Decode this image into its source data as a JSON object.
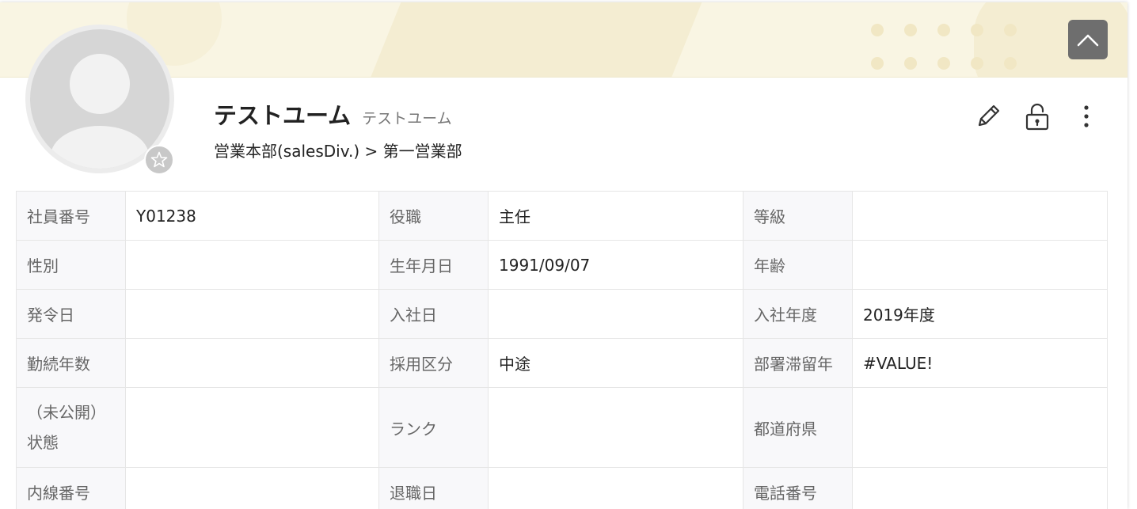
{
  "profile": {
    "name": "テストユーム",
    "name_kana": "テストユーム",
    "department_path": "営業本部(salesDiv.) > 第一営業部"
  },
  "colors": {
    "banner": "#f9f5e3",
    "dots": "#f1e7c4",
    "top_button": "#6e6e6e",
    "label_bg": "#f8f8fa"
  },
  "icons": {
    "scroll_top": "chevron-up-icon",
    "favorite": "star-outline-icon",
    "edit": "pencil-icon",
    "lock": "lock-icon",
    "more": "more-vertical-icon",
    "avatar": "user-silhouette-icon"
  },
  "table": {
    "rows": [
      [
        {
          "label": "社員番号",
          "value": "Y01238"
        },
        {
          "label": "役職",
          "value": "主任"
        },
        {
          "label": "等級",
          "value": ""
        }
      ],
      [
        {
          "label": "性別",
          "value": ""
        },
        {
          "label": "生年月日",
          "value": "1991/09/07"
        },
        {
          "label": "年齢",
          "value": ""
        }
      ],
      [
        {
          "label": "発令日",
          "value": ""
        },
        {
          "label": "入社日",
          "value": ""
        },
        {
          "label": "入社年度",
          "value": "2019年度"
        }
      ],
      [
        {
          "label": "勤続年数",
          "value": ""
        },
        {
          "label": "採用区分",
          "value": "中途"
        },
        {
          "label": "部署滞留年",
          "value": "#VALUE!"
        }
      ],
      [
        {
          "label": "（未公開）状態",
          "value": ""
        },
        {
          "label": "ランク",
          "value": ""
        },
        {
          "label": "都道府県",
          "value": ""
        }
      ],
      [
        {
          "label": "内線番号",
          "value": ""
        },
        {
          "label": "退職日",
          "value": ""
        },
        {
          "label": "電話番号",
          "value": ""
        }
      ]
    ]
  }
}
